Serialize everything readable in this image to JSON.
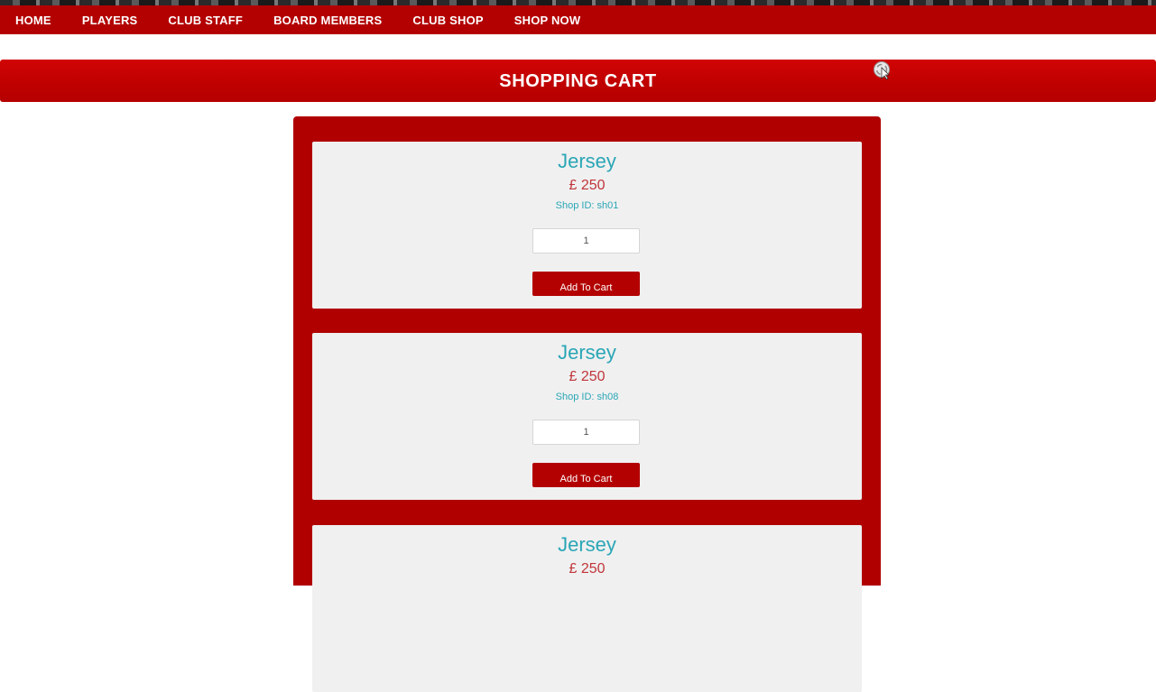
{
  "nav": {
    "items": [
      {
        "label": "HOME"
      },
      {
        "label": "PLAYERS"
      },
      {
        "label": "CLUB STAFF"
      },
      {
        "label": "BOARD MEMBERS"
      },
      {
        "label": "CLUB SHOP"
      },
      {
        "label": "SHOP NOW"
      }
    ]
  },
  "header": {
    "title": "SHOPPING CART"
  },
  "products": [
    {
      "name": "Jersey",
      "price": "£ 250",
      "shop_id": "Shop ID: sh01",
      "quantity": "1",
      "button_label": "Add To Cart"
    },
    {
      "name": "Jersey",
      "price": "£ 250",
      "shop_id": "Shop ID: sh08",
      "quantity": "1",
      "button_label": "Add To Cart"
    },
    {
      "name": "Jersey",
      "price": "£ 250"
    }
  ],
  "colors": {
    "brand_red": "#b30000",
    "title_teal": "#2aa6b6",
    "price_red": "#c0353a",
    "card_bg": "#f0f0f0"
  }
}
